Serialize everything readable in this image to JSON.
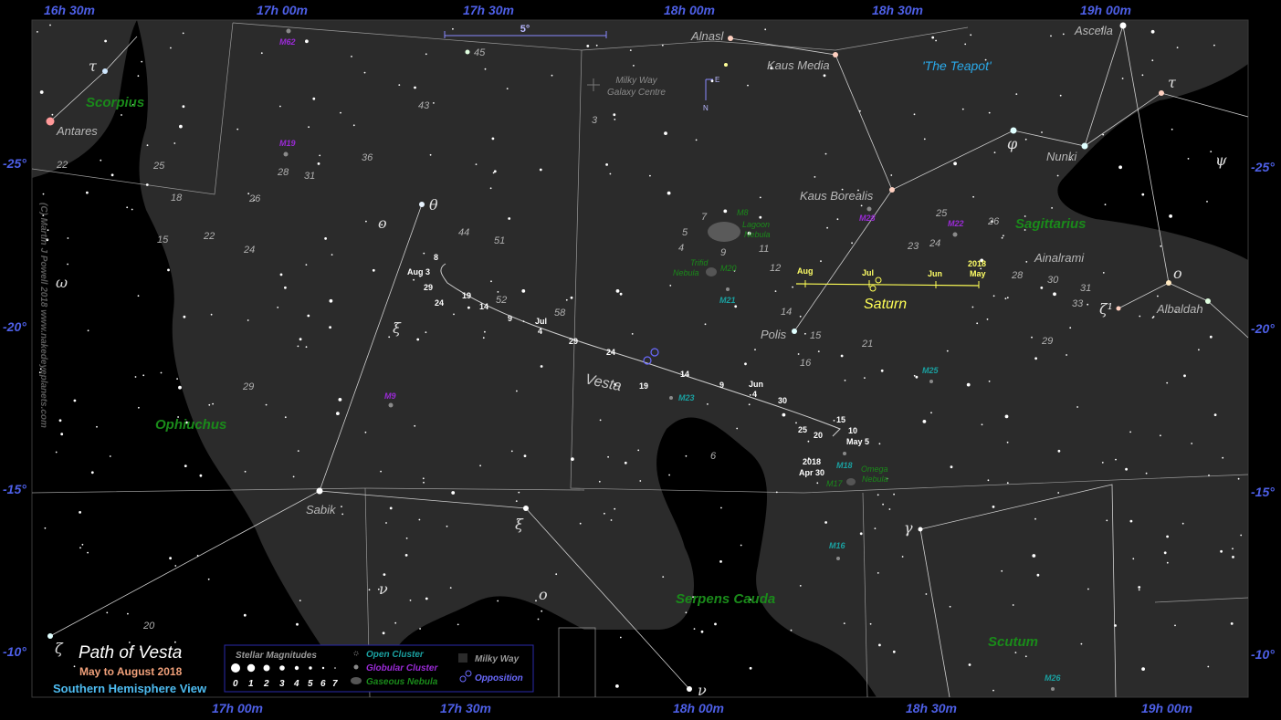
{
  "ra_labels_top": [
    "16h 30m",
    "17h 00m",
    "17h 30m",
    "18h 00m",
    "18h 30m",
    "19h 00m"
  ],
  "ra_labels_bottom": [
    "17h 00m",
    "17h 30m",
    "18h 00m",
    "18h 30m",
    "19h 00m"
  ],
  "dec_labels_left": [
    "-25°",
    "-20°",
    "-15°",
    "-10°"
  ],
  "dec_labels_right": [
    "-25°",
    "-20°",
    "-15°",
    "-10°"
  ],
  "scale_bar": "5°",
  "compass": {
    "east": "E",
    "north": "N"
  },
  "copyright": "(C) Martin J Powell 2018 www.nakedeyeplanets.com",
  "constellations": [
    "Scorpius",
    "Ophiuchus",
    "Sagittarius",
    "Serpens Cauda",
    "Scutum"
  ],
  "asterism": "'The Teapot'",
  "galaxy_centre": [
    "Milky Way",
    "Galaxy Centre"
  ],
  "star_names": [
    "Antares",
    "Alnasl",
    "Kaus Media",
    "Ascella",
    "Nunki",
    "Kaus Borealis",
    "Ainalrami",
    "Albaldah",
    "Polis",
    "Sabik"
  ],
  "greek_labels": [
    "τ",
    "θ",
    "ο",
    "ω",
    "ξ",
    "φ",
    "τ",
    "ψ",
    "ο",
    "ζ¹",
    "γ",
    "ξ",
    "ν",
    "ο",
    "ζ",
    "ν"
  ],
  "magnitude_labels": [
    "45",
    "43",
    "3",
    "22",
    "25",
    "18",
    "26",
    "28",
    "31",
    "36",
    "15",
    "22",
    "24",
    "44",
    "51",
    "29",
    "52",
    "58",
    "7",
    "5",
    "4",
    "9",
    "11",
    "12",
    "14",
    "15",
    "16",
    "21",
    "29",
    "25",
    "26",
    "23",
    "24",
    "28",
    "30",
    "31",
    "33",
    "6",
    "20"
  ],
  "deep_sky": {
    "globular": [
      "M62",
      "M19",
      "M9",
      "M28",
      "M22"
    ],
    "open": [
      "M21",
      "M23",
      "M18",
      "M16",
      "M25",
      "M26"
    ],
    "nebula": [
      "M8",
      "Lagoon",
      "Nebula",
      "Trifid",
      "Nebula",
      "M20",
      "M17",
      "Omega",
      "Nebula"
    ]
  },
  "vesta": {
    "label": "Vesta",
    "dates": [
      "8",
      "Aug 3",
      "29",
      "24",
      "19",
      "14",
      "9",
      "Jul",
      "4",
      "29",
      "24",
      "19",
      "14",
      "9",
      "Jun",
      "4",
      "30",
      "25",
      "20",
      "15",
      "10",
      "May 5",
      "2018",
      "Apr 30"
    ]
  },
  "saturn": {
    "label": "Saturn",
    "dates": [
      "Aug",
      "Jul",
      "Jun",
      "2018",
      "May"
    ]
  },
  "title": {
    "main": "Path of Vesta",
    "sub": "May to August 2018",
    "hemisphere": "Southern Hemisphere View"
  },
  "legend": {
    "stellar_title": "Stellar Magnitudes",
    "magnitudes": [
      "0",
      "1",
      "2",
      "3",
      "4",
      "5",
      "6",
      "7"
    ],
    "open_cluster": "Open Cluster",
    "globular_cluster": "Globular Cluster",
    "gaseous_nebula": "Gaseous Nebula",
    "milky_way": "Milky Way",
    "opposition": "Opposition"
  },
  "colors": {
    "milky_way": "#2b2b2b",
    "background": "#000000",
    "constellation_name": "#1a8a1a",
    "frame_label": "#4d5fe6",
    "saturn": "#ffff55",
    "asterism": "#2aa8e8"
  }
}
